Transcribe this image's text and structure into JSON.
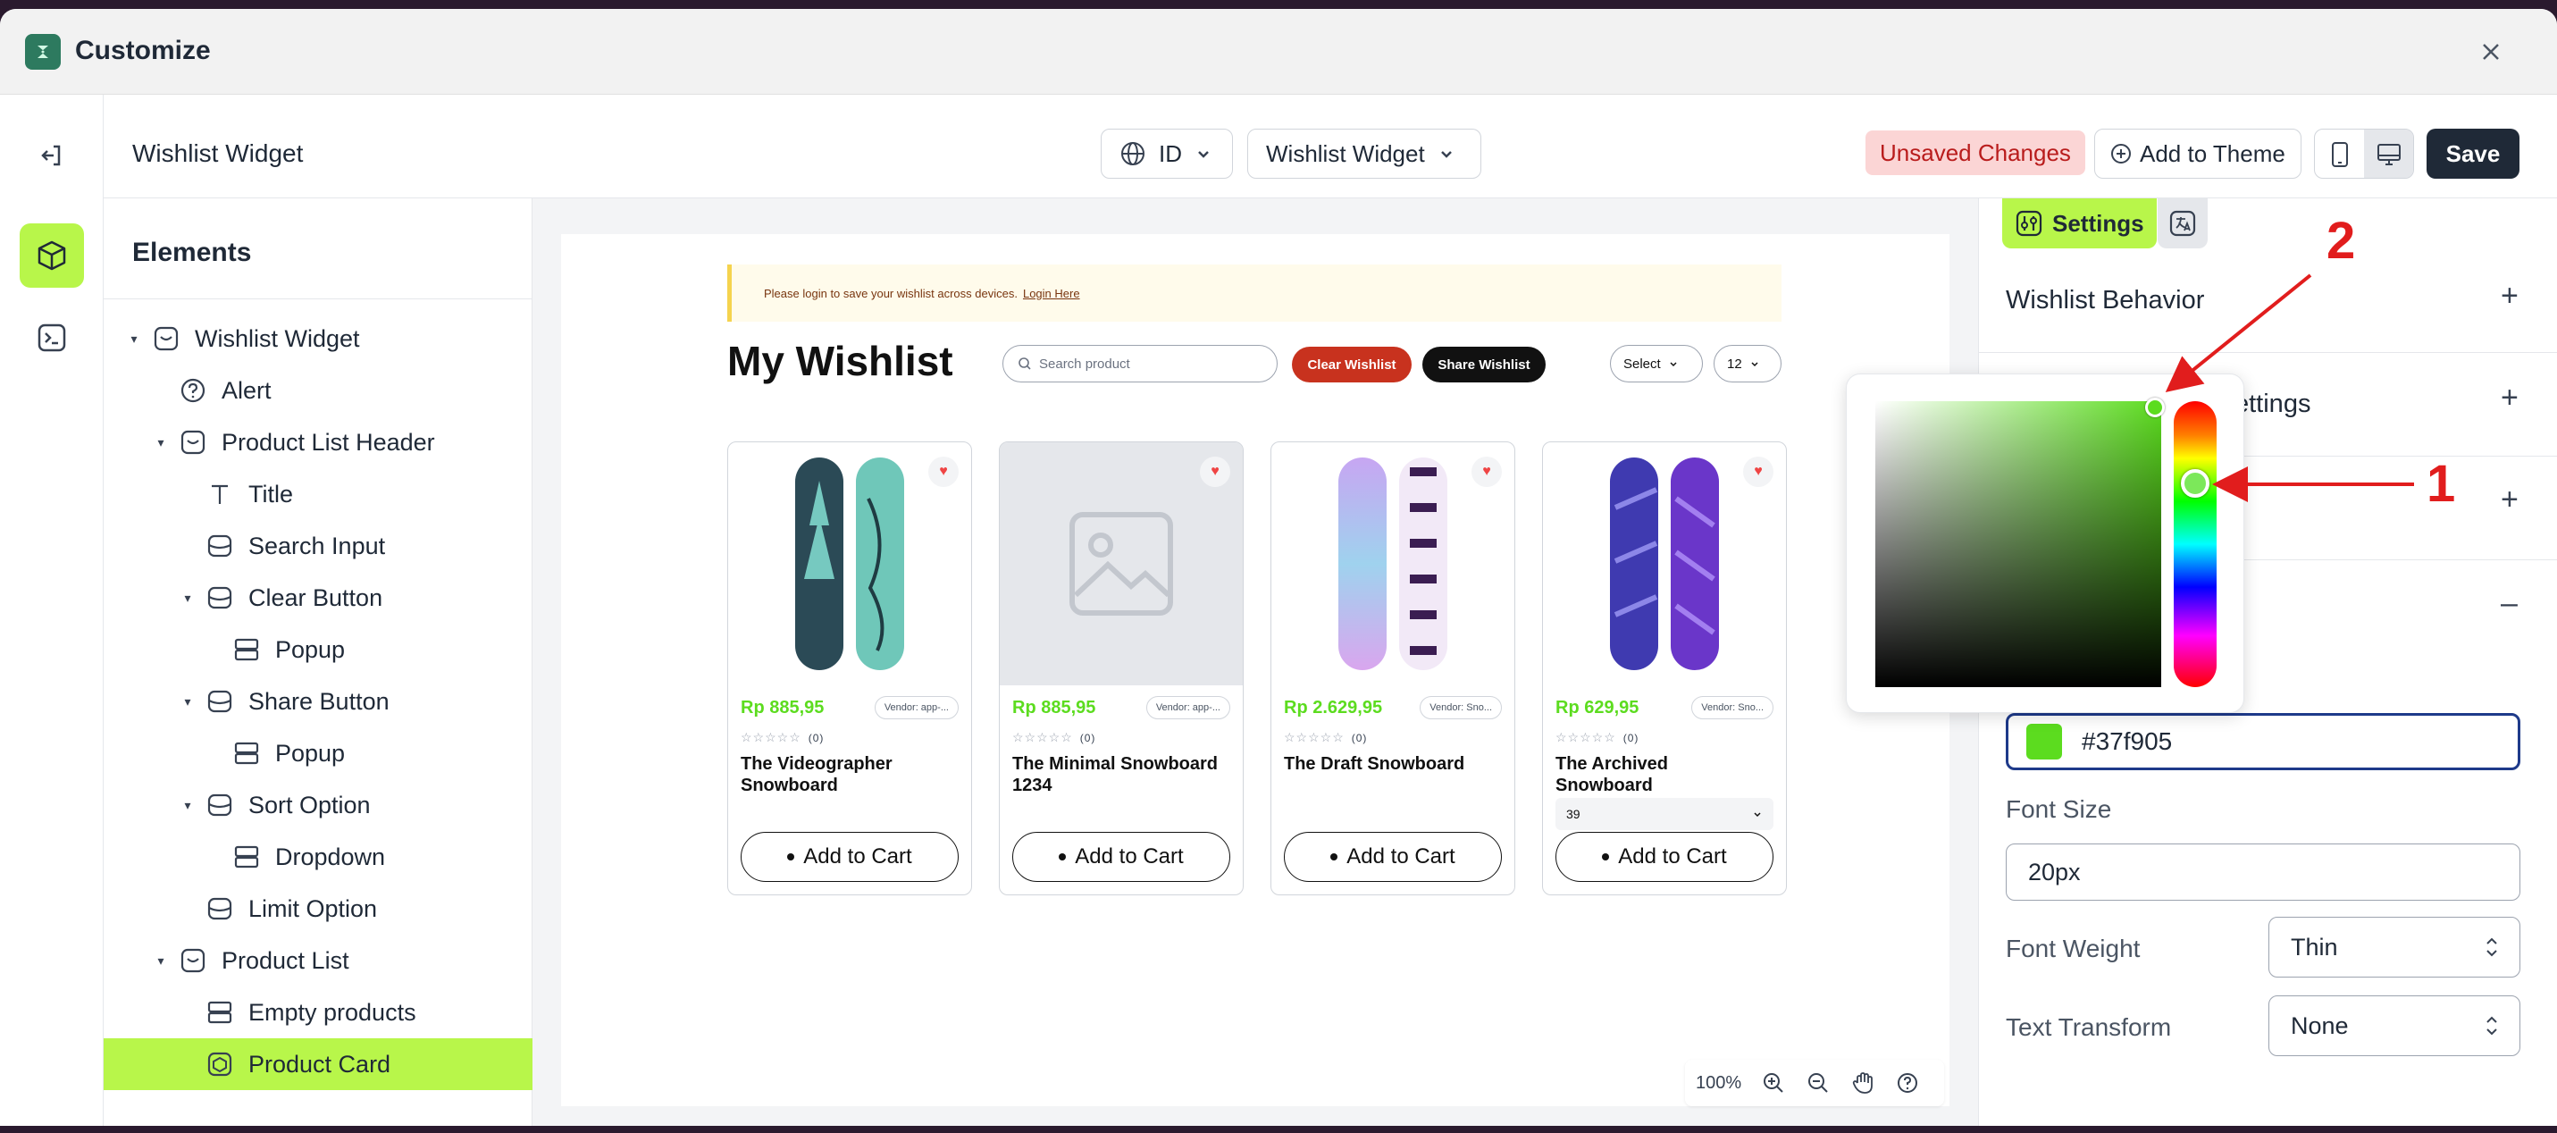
{
  "app": {
    "title": "Customize"
  },
  "topbar": {
    "page_name": "Wishlist Widget",
    "language": "ID",
    "template": "Wishlist Widget",
    "unsaved": "Unsaved Changes",
    "add_to_theme": "Add to Theme",
    "save": "Save"
  },
  "elements": {
    "title": "Elements",
    "tree": [
      {
        "label": "Wishlist Widget",
        "icon": "widget-icon",
        "caret": true
      },
      {
        "label": "Alert",
        "icon": "question-circle-icon",
        "caret": false
      },
      {
        "label": "Product List Header",
        "icon": "widget-icon",
        "caret": true
      },
      {
        "label": "Title",
        "icon": "text-t-icon",
        "caret": false
      },
      {
        "label": "Search Input",
        "icon": "component-icon",
        "caret": false
      },
      {
        "label": "Clear Button",
        "icon": "component-icon",
        "caret": true
      },
      {
        "label": "Popup",
        "icon": "rows-icon",
        "caret": false
      },
      {
        "label": "Share Button",
        "icon": "component-icon",
        "caret": true
      },
      {
        "label": "Popup",
        "icon": "rows-icon",
        "caret": false
      },
      {
        "label": "Sort Option",
        "icon": "component-icon",
        "caret": true
      },
      {
        "label": "Dropdown",
        "icon": "rows-icon",
        "caret": false
      },
      {
        "label": "Limit Option",
        "icon": "component-icon",
        "caret": false
      },
      {
        "label": "Product List",
        "icon": "widget-icon",
        "caret": true
      },
      {
        "label": "Empty products",
        "icon": "rows-icon",
        "caret": false
      },
      {
        "label": "Product Card",
        "icon": "product-card-icon",
        "caret": false,
        "selected": true
      }
    ]
  },
  "preview": {
    "alert_text": "Please login to save your wishlist across devices.",
    "alert_link": "Login Here",
    "title": "My Wishlist",
    "search_placeholder": "Search product",
    "clear_btn": "Clear Wishlist",
    "share_btn": "Share Wishlist",
    "sort": "Select",
    "limit": "12",
    "products": [
      {
        "price": "Rp 885,95",
        "vendor": "Vendor: app-...",
        "reviews": "(0)",
        "name": "The Videographer Snowboard",
        "add": "Add to Cart",
        "variant": ""
      },
      {
        "price": "Rp 885,95",
        "vendor": "Vendor: app-...",
        "reviews": "(0)",
        "name": "The Minimal Snowboard 1234",
        "add": "Add to Cart",
        "variant": ""
      },
      {
        "price": "Rp 2.629,95",
        "vendor": "Vendor: Sno...",
        "reviews": "(0)",
        "name": "The Draft Snowboard",
        "add": "Add to Cart",
        "variant": ""
      },
      {
        "price": "Rp 629,95",
        "vendor": "Vendor: Sno...",
        "reviews": "(0)",
        "name": "The Archived Snowboard",
        "add": "Add to Cart",
        "variant": "39"
      }
    ],
    "zoom": "100%"
  },
  "settings": {
    "tab": "Settings",
    "sections": {
      "behavior": "Wishlist Behavior",
      "second_partial": "ettings"
    },
    "color_value": "#37f905",
    "font_size_label": "Font Size",
    "font_size": "20px",
    "font_weight_label": "Font Weight",
    "font_weight": "Thin",
    "text_transform_label": "Text Transform",
    "text_transform": "None"
  },
  "annotations": {
    "one": "1",
    "two": "2"
  },
  "colors": {
    "accent": "#b8f64a",
    "price": "#5cdc1f",
    "swatch": "#5cdc1f",
    "annotation": "#e11d1d"
  }
}
